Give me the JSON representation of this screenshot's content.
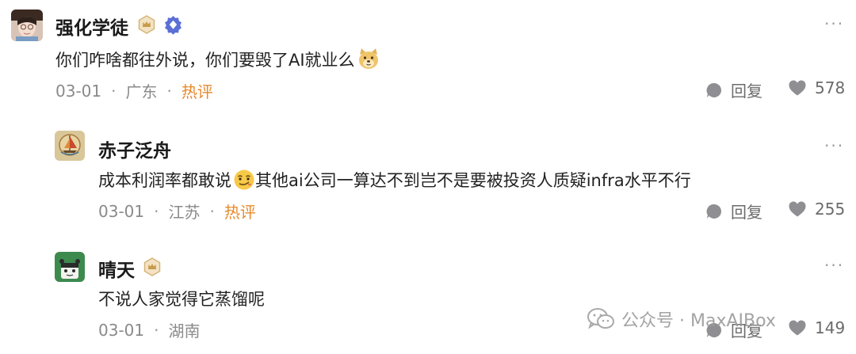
{
  "comments": [
    {
      "user": "强化学徒",
      "text": "你们咋啥都往外说，你们要毁了AI就业么",
      "date": "03-01",
      "location": "广东",
      "tag": "热评",
      "reply_label": "回复",
      "likes": "578"
    },
    {
      "user": "赤子泛舟",
      "text_before": "成本利润率都敢说",
      "text_after": "其他ai公司一算达不到岂不是要被投资人质疑infra水平不行",
      "date": "03-01",
      "location": "江苏",
      "tag": "热评",
      "reply_label": "回复",
      "likes": "255"
    },
    {
      "user": "晴天",
      "text": "不说人家觉得它蒸馏呢",
      "date": "03-01",
      "location": "湖南",
      "reply_label": "回复",
      "likes": "149"
    }
  ],
  "more_label": "···",
  "separator": "·",
  "watermark": "公众号 · MaxAIBox",
  "colors": {
    "hot_tag": "#e8892b",
    "meta": "#8a8a8a",
    "icon": "#8e8e93"
  }
}
